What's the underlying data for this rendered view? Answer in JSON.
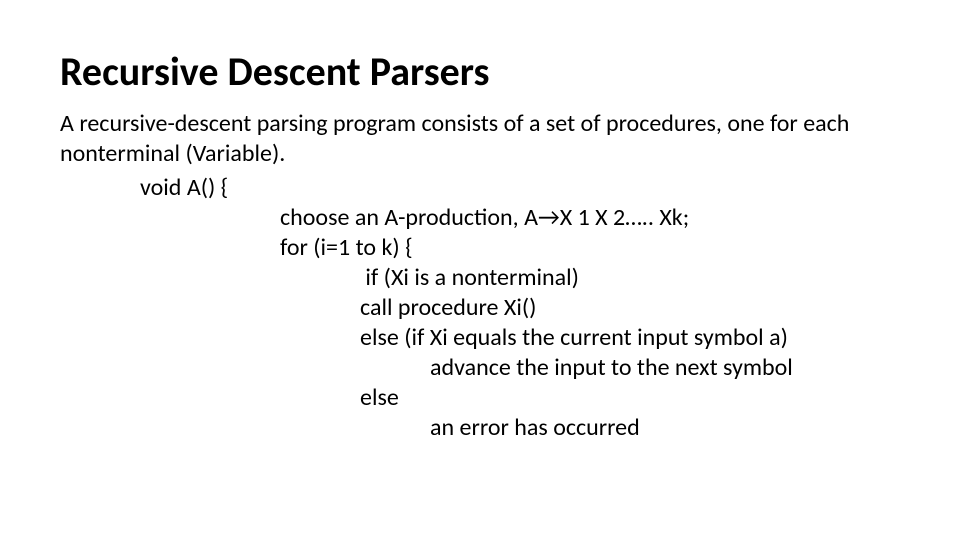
{
  "slide": {
    "title": "Recursive Descent Parsers",
    "intro": "A recursive-descent parsing program consists of a set of procedures, one for each nonterminal (Variable).",
    "code": {
      "l1": "void A() {",
      "l2": "choose an A-production, A→X 1 X 2….. Xk;",
      "l3": "for (i=1 to k) {",
      "l4": " if (Xi is a nonterminal)",
      "l5": "call procedure Xi()",
      "l6": "else (if Xi equals the current input symbol a)",
      "l7": "advance the input to the next symbol",
      "l8": "else",
      "l9": "an error has occurred"
    }
  }
}
